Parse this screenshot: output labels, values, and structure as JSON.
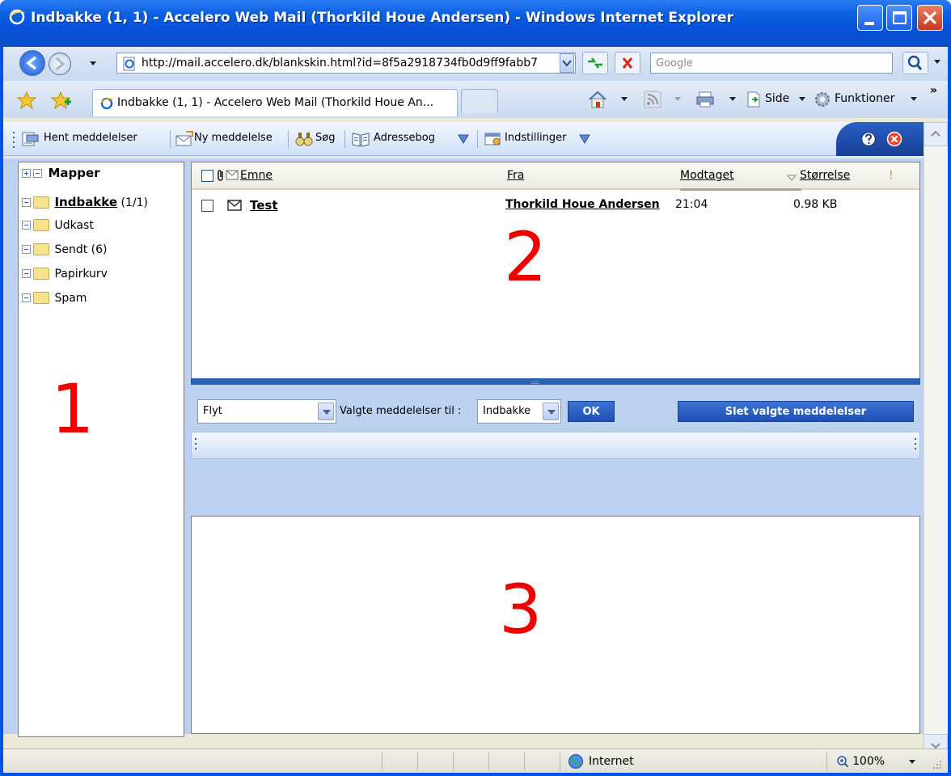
{
  "window": {
    "title": "Indbakke (1, 1) - Accelero Web Mail (Thorkild Houe Andersen) - Windows Internet Explorer"
  },
  "browser": {
    "url": "http://mail.accelero.dk/blankskin.html?id=8f5a2918734fb0d9ff9fabb7",
    "search_placeholder": "Google",
    "tab_title": "Indbakke (1, 1) - Accelero Web Mail (Thorkild Houe An...",
    "side_label": "Side",
    "tools_label": "Funktioner",
    "chevron_label": "»"
  },
  "toolbar": {
    "get_messages": "Hent meddelelser",
    "new_message": "Ny meddelelse",
    "search": "Søg",
    "address_book": "Adressebog",
    "settings": "Indstillinger"
  },
  "folders": {
    "header": "Mapper",
    "items": [
      {
        "name": "Indbakke",
        "count": "(1/1)"
      },
      {
        "name": "Udkast",
        "count": ""
      },
      {
        "name": "Sendt (6)",
        "count": ""
      },
      {
        "name": "Papirkurv",
        "count": ""
      },
      {
        "name": "Spam",
        "count": ""
      }
    ]
  },
  "message_list": {
    "columns": {
      "subject": "Emne",
      "from": "Fra",
      "received": "Modtaget",
      "size": "Størrelse",
      "priority": "!"
    },
    "rows": [
      {
        "subject": "Test",
        "from": "Thorkild Houe Andersen",
        "received": "21:04",
        "size": "0.98 KB"
      }
    ]
  },
  "actions": {
    "action_select": "Flyt",
    "selected_to_label": "Valgte meddelelser til :",
    "target_folder": "Indbakke",
    "ok": "OK",
    "delete_selected": "Slet valgte meddelelser"
  },
  "annotations": {
    "one": "1",
    "two": "2",
    "three": "3"
  },
  "statusbar": {
    "zone": "Internet",
    "zoom": "100%"
  },
  "colors": {
    "titlebar": "#0553d6",
    "annotation": "#e00000",
    "toolbar_accent": "#1f4fb2"
  }
}
